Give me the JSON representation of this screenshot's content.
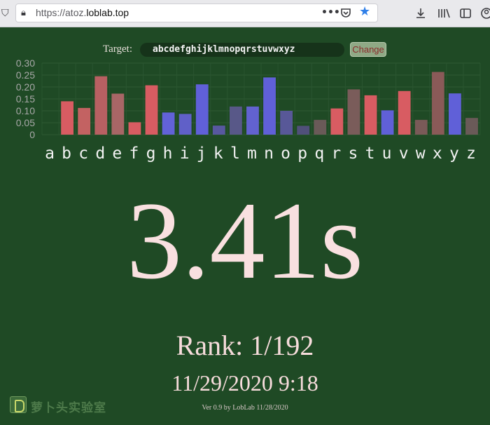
{
  "browser": {
    "url_prefix": "https://atoz.",
    "url_host": "loblab.top",
    "icons": [
      "shield-icon",
      "lock-icon",
      "more-icon",
      "pocket-icon",
      "star-icon",
      "download-icon",
      "library-icon",
      "sidebar-icon",
      "account-icon"
    ]
  },
  "target": {
    "label": "Target:",
    "value": "abcdefghijklmnopqrstuvwxyz",
    "change_label": "Change"
  },
  "chart_data": {
    "type": "bar",
    "categories": [
      "a",
      "b",
      "c",
      "d",
      "e",
      "f",
      "g",
      "h",
      "i",
      "j",
      "k",
      "l",
      "m",
      "n",
      "o",
      "p",
      "q",
      "r",
      "s",
      "t",
      "u",
      "v",
      "w",
      "x",
      "y",
      "z"
    ],
    "values": [
      0.0,
      0.14,
      0.112,
      0.245,
      0.172,
      0.052,
      0.207,
      0.093,
      0.087,
      0.211,
      0.038,
      0.118,
      0.118,
      0.24,
      0.1,
      0.037,
      0.062,
      0.11,
      0.19,
      0.165,
      0.102,
      0.183,
      0.062,
      0.263,
      0.173,
      0.07
    ],
    "colors": [
      "#1f4a25",
      "#d85c62",
      "#c36262",
      "#b86062",
      "#a86666",
      "#d85c62",
      "#d85c62",
      "#6262d8",
      "#6060c8",
      "#6060d8",
      "#5858a0",
      "#585888",
      "#6262d0",
      "#6060d8",
      "#585898",
      "#50507a",
      "#6a5a58",
      "#d85c62",
      "#7a5c5a",
      "#d85c62",
      "#6060d8",
      "#d85c62",
      "#7a5a58",
      "#8a5a58",
      "#6060d8",
      "#6a5a58"
    ],
    "yticks": [
      "0.30",
      "0.25",
      "0.20",
      "0.15",
      "0.10",
      "0.05",
      "0"
    ],
    "ylim": [
      0,
      0.3
    ],
    "grid": true
  },
  "result": {
    "time": "3.41s",
    "rank": "Rank: 1/192",
    "datetime": "11/29/2020 9:18",
    "version": "Ver 0.9 by LobLab 11/28/2020"
  },
  "logo": {
    "text": "萝卜头实验室"
  }
}
